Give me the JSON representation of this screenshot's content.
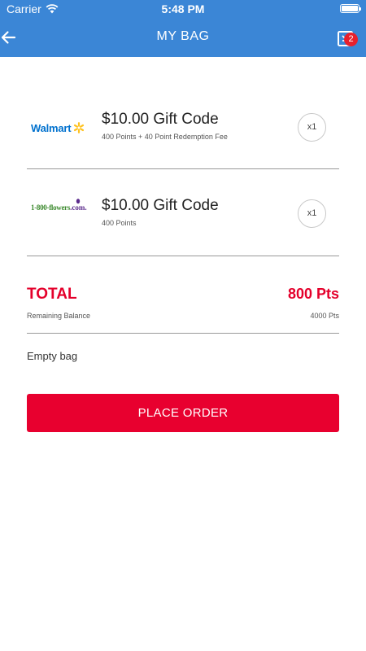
{
  "status_bar": {
    "carrier": "Carrier",
    "time": "5:48 PM",
    "icons": [
      "wifi-icon",
      "battery-icon"
    ]
  },
  "nav": {
    "title": "MY BAG",
    "back_icon": "back-arrow-icon",
    "bag_icon": "shopping-bag-icon",
    "bag_badge": "2",
    "color": "#3b86d6"
  },
  "items": [
    {
      "brand_logo": "Walmart",
      "title": "$10.00 Gift Code",
      "subtitle": "400 Points + 40 Point Redemption Fee",
      "quantity": "x1",
      "logo_color": "#0071ce",
      "spark_color": "#ffc220"
    },
    {
      "brand_logo": "1-800-flowers",
      "brand_logo_suffix": ".com.",
      "title": "$10.00 Gift Code",
      "subtitle": "400 Points",
      "quantity": "x1",
      "logo_color": "#3d8a2f",
      "suffix_color": "#5b2b8c"
    }
  ],
  "summary": {
    "total_label": "TOTAL",
    "total_value": "800 Pts",
    "remaining_label": "Remaining Balance",
    "remaining_value": "4000 Pts",
    "accent": "#e4002b"
  },
  "actions": {
    "empty_bag": "Empty bag",
    "place_order": "PLACE ORDER",
    "button_color": "#e8002f"
  }
}
